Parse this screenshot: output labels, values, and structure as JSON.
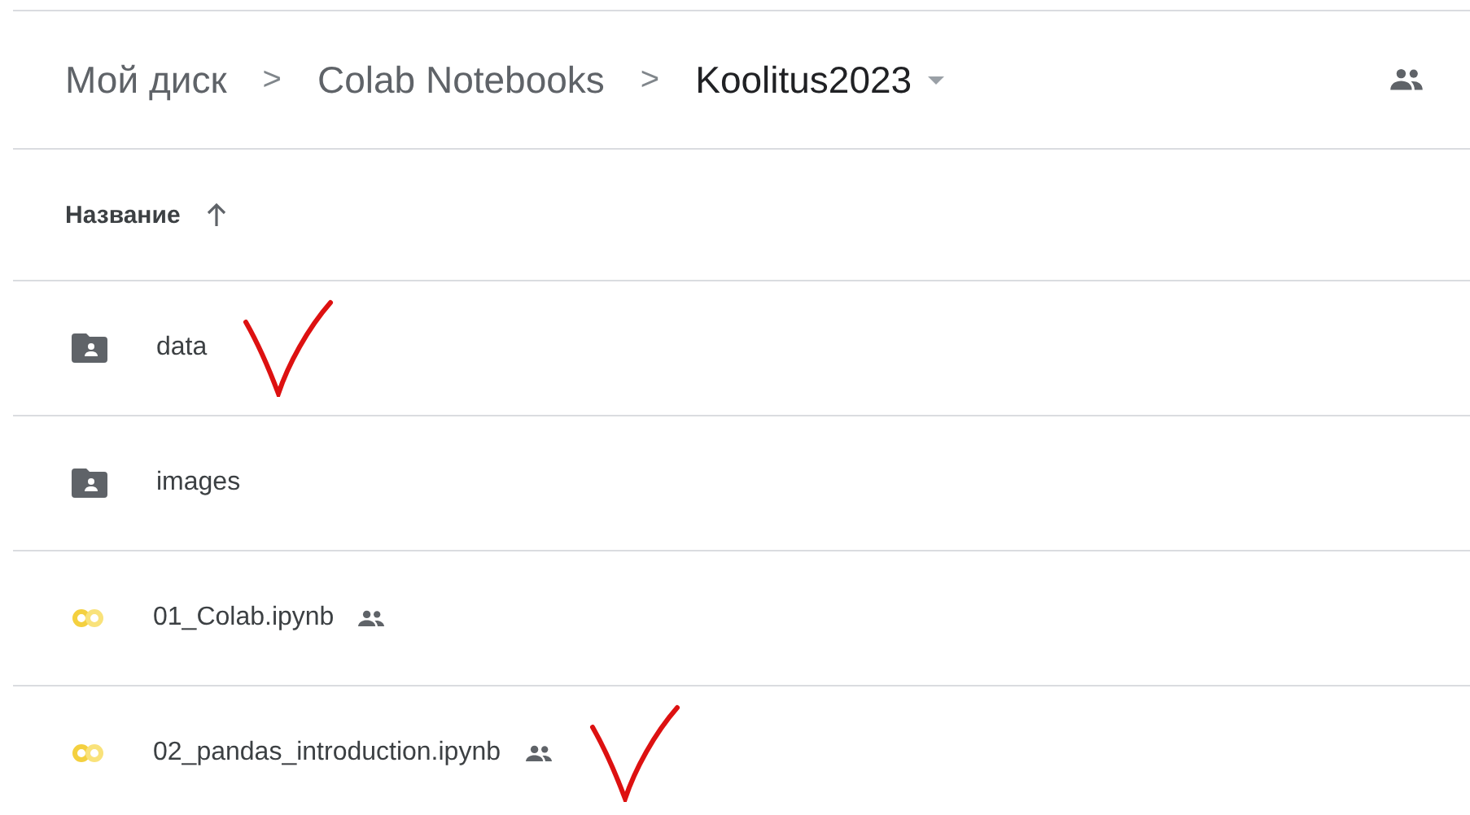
{
  "breadcrumb": {
    "items": [
      "Мой диск",
      "Colab Notebooks"
    ],
    "current": "Koolitus2023",
    "separator": ">",
    "shared": true
  },
  "list_header": {
    "label": "Название",
    "sort_ascending": true
  },
  "rows": [
    {
      "kind": "folder",
      "name": "data",
      "shared": false,
      "checkmark": true
    },
    {
      "kind": "folder",
      "name": "images",
      "shared": false,
      "checkmark": false
    },
    {
      "kind": "notebook",
      "name": "01_Colab.ipynb",
      "shared": true,
      "checkmark": false
    },
    {
      "kind": "notebook",
      "name": "02_pandas_introduction.ipynb",
      "shared": true,
      "checkmark": true
    }
  ]
}
